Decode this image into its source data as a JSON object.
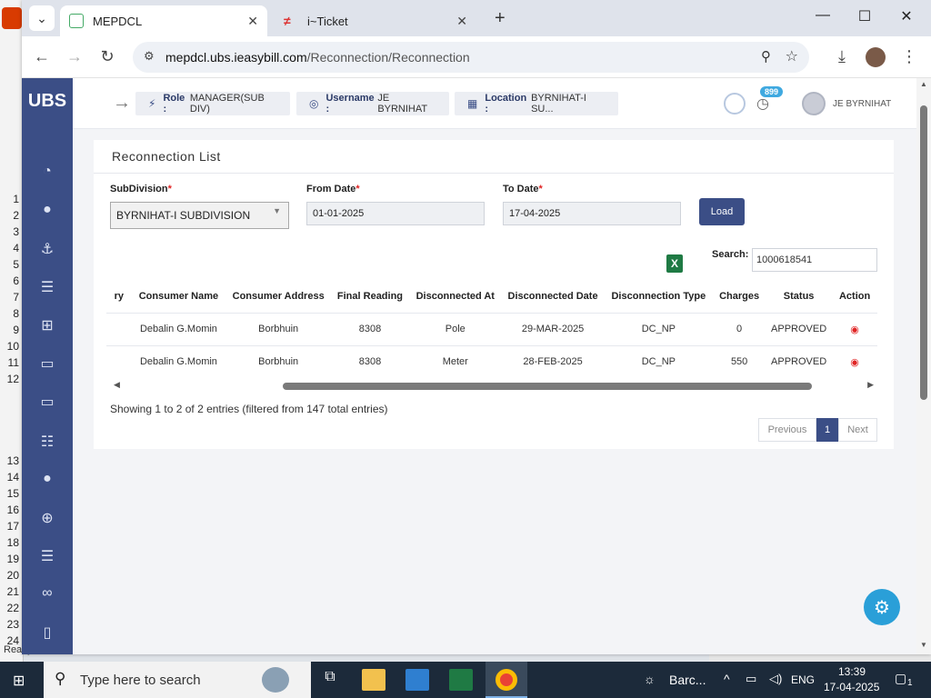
{
  "excel": {
    "rows": [
      "1",
      "2",
      "3",
      "4",
      "5",
      "6",
      "7",
      "8",
      "9",
      "10",
      "11",
      "12",
      "",
      "",
      "",
      "",
      "13",
      "14",
      "15",
      "16",
      "17",
      "18",
      "19",
      "20",
      "21",
      "22",
      "23",
      "24"
    ],
    "status": "Ready"
  },
  "browser": {
    "tabs": [
      {
        "title": "MEPDCL",
        "active": true
      },
      {
        "title": "i~Ticket",
        "active": false
      }
    ],
    "url_host": "mepdcl.ubs.ieasybill.com",
    "url_path": "/Reconnection/Reconnection"
  },
  "app": {
    "logo": "UBS",
    "role_label": "Role :",
    "role_value": "MANAGER(SUB DIV)",
    "username_label": "Username :",
    "username_value": "JE BYRNIHAT",
    "location_label": "Location :",
    "location_value": "BYRNIHAT-I SU...",
    "notification_count": "899",
    "user_name": "JE BYRNIHAT"
  },
  "card": {
    "title": "Reconnection List",
    "subdivision_label": "SubDivision",
    "subdivision_value": "BYRNIHAT-I SUBDIVISION",
    "from_label": "From Date",
    "from_value": "01-01-2025",
    "to_label": "To Date",
    "to_value": "17-04-2025",
    "required_mark": "*",
    "load_label": "Load",
    "search_label": "Search:",
    "search_value": "1000618541"
  },
  "table": {
    "headers": [
      "ry",
      "Consumer Name",
      "Consumer Address",
      "Final Reading",
      "Disconnected At",
      "Disconnected Date",
      "Disconnection Type",
      "Charges",
      "Status",
      "Action"
    ],
    "rows": [
      [
        "",
        "Debalin G.Momin",
        "Borbhuin",
        "8308",
        "Pole",
        "29-MAR-2025",
        "DC_NP",
        "0",
        "APPROVED"
      ],
      [
        "",
        "Debalin G.Momin",
        "Borbhuin",
        "8308",
        "Meter",
        "28-FEB-2025",
        "DC_NP",
        "550",
        "APPROVED"
      ]
    ]
  },
  "footer": {
    "info": "Showing 1 to 2 of 2 entries (filtered from 147 total entries)",
    "prev": "Previous",
    "page": "1",
    "next": "Next"
  },
  "taskbar": {
    "search_placeholder": "Type here to search",
    "weather": "Barc...",
    "lang": "ENG",
    "time": "13:39",
    "date": "17-04-2025",
    "notif": "1"
  }
}
